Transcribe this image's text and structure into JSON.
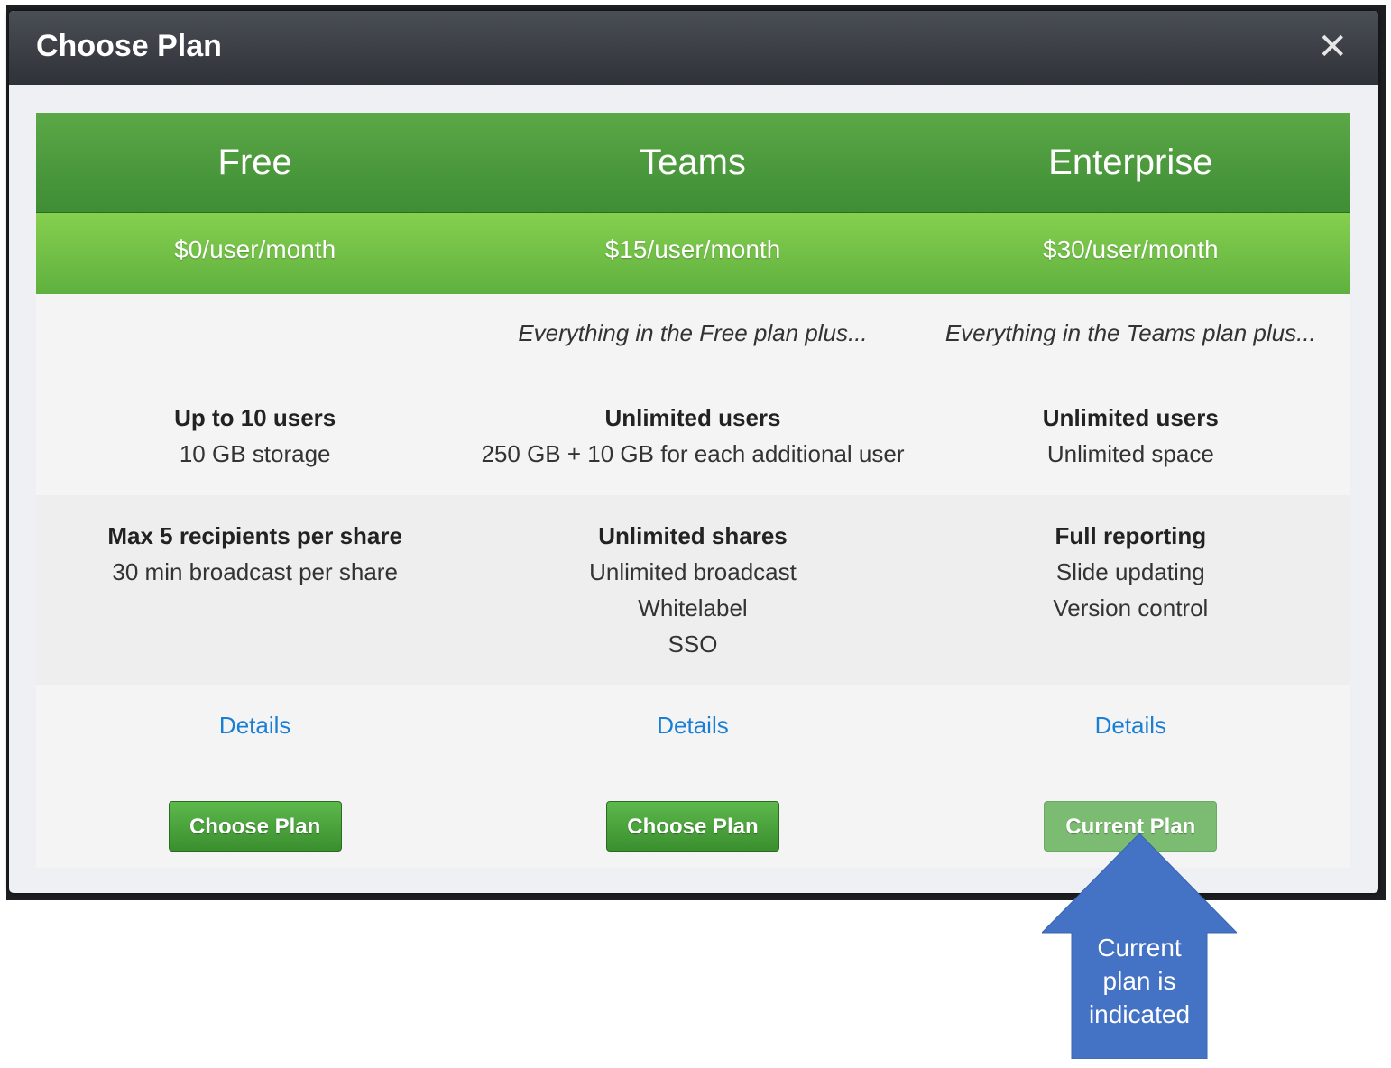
{
  "modal": {
    "title": "Choose Plan",
    "close_symbol": "✕"
  },
  "plans": [
    {
      "name": "Free",
      "price": "$0/user/month",
      "intro": "",
      "users_bold": "Up to 10 users",
      "users_lines": [
        "10 GB storage"
      ],
      "share_bold": "Max 5 recipients per share",
      "share_lines": [
        "30 min broadcast per share"
      ],
      "details_label": "Details",
      "button_label": "Choose Plan",
      "is_current": false
    },
    {
      "name": "Teams",
      "price": "$15/user/month",
      "intro": "Everything in the Free plan plus...",
      "users_bold": "Unlimited users",
      "users_lines": [
        "250 GB + 10 GB for each additional user"
      ],
      "share_bold": "Unlimited shares",
      "share_lines": [
        "Unlimited broadcast",
        "Whitelabel",
        "SSO"
      ],
      "details_label": "Details",
      "button_label": "Choose Plan",
      "is_current": false
    },
    {
      "name": "Enterprise",
      "price": "$30/user/month",
      "intro": "Everything in the Teams plan plus...",
      "users_bold": "Unlimited users",
      "users_lines": [
        "Unlimited space"
      ],
      "share_bold": "Full reporting",
      "share_lines": [
        "Slide updating",
        "Version control"
      ],
      "details_label": "Details",
      "button_label": "Current Plan",
      "is_current": true
    }
  ],
  "callout": {
    "lines": [
      "Current",
      "plan is",
      "indicated"
    ]
  },
  "colors": {
    "header_green": "#4a9a3e",
    "price_green": "#74c248",
    "link_blue": "#1a7fd4",
    "callout_blue": "#4472c4"
  }
}
